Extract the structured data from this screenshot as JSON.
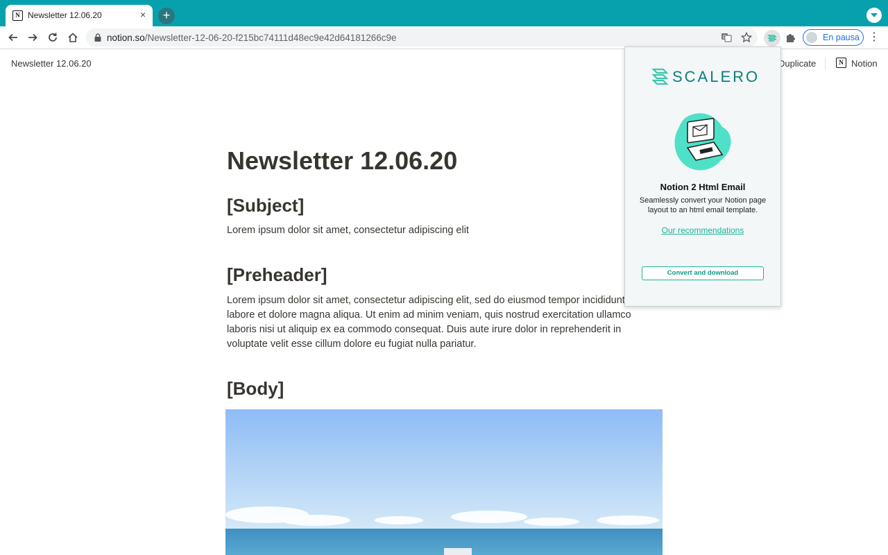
{
  "browser": {
    "tab": {
      "title": "Newsletter 12.06.20",
      "favicon": "notion-icon",
      "close": "×"
    },
    "new_tab": "+",
    "url": {
      "domain": "notion.so",
      "path": "/Newsletter-12-06-20-f215bc74111d48ec9e42d64181266c9e"
    },
    "profile": {
      "label": "En pausa"
    },
    "colors": {
      "tabstrip": "#07a1ae",
      "profile_accent": "#1a73e8"
    }
  },
  "notion": {
    "breadcrumb": "Newsletter 12.06.20",
    "duplicate_label": "Duplicate",
    "notion_label": "Notion",
    "page": {
      "title": "Newsletter 12.06.20",
      "subject_heading": "[Subject]",
      "subject_text": "Lorem ipsum dolor sit amet, consectetur adipiscing elit",
      "preheader_heading": "[Preheader]",
      "preheader_text": "Lorem ipsum dolor sit amet, consectetur adipiscing elit, sed do eiusmod tempor incididunt ut labore et dolore magna aliqua. Ut enim ad minim veniam, quis nostrud exercitation ullamco laboris nisi ut aliquip ex ea commodo consequat. Duis aute irure dolor in reprehenderit in voluptate velit esse cillum dolore eu fugiat nulla pariatur.",
      "body_heading": "[Body]"
    }
  },
  "extension": {
    "brand": "SCALERO",
    "title": "Notion 2 Html Email",
    "description": "Seamlessly convert your Notion page layout to an html email template.",
    "link": "Our recommendations",
    "button": "Convert and download",
    "colors": {
      "accent": "#17b39a",
      "brand": "#0d7f78"
    }
  }
}
